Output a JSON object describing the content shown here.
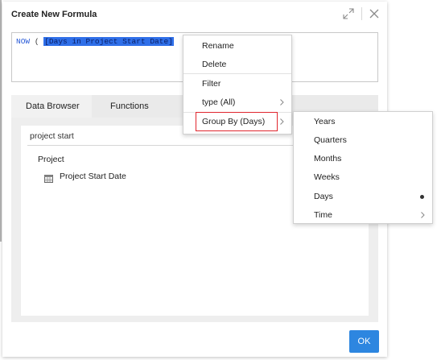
{
  "dialog": {
    "title": "Create New Formula",
    "expand_icon": "expand-icon",
    "close_icon": "close-icon"
  },
  "formula": {
    "function_name": "NOW",
    "open_paren": "(",
    "argument": "[Days in Project Start Date]"
  },
  "tabs": [
    {
      "label": "Data Browser",
      "active": true
    },
    {
      "label": "Functions",
      "active": false
    }
  ],
  "data_browser": {
    "search_value": "project start",
    "group": "Project",
    "items": [
      {
        "label": "Project Start Date",
        "icon": "table-icon"
      }
    ]
  },
  "context_menu": {
    "items": [
      {
        "label": "Rename"
      },
      {
        "label": "Delete"
      },
      {
        "label": "Filter"
      },
      {
        "label": "type (All)",
        "has_submenu": true
      },
      {
        "label": "Group By (Days)",
        "has_submenu": true,
        "highlighted": true
      }
    ]
  },
  "group_by_submenu": {
    "items": [
      {
        "label": "Years"
      },
      {
        "label": "Quarters"
      },
      {
        "label": "Months"
      },
      {
        "label": "Weeks"
      },
      {
        "label": "Days",
        "selected": true
      },
      {
        "label": "Time",
        "has_submenu": true
      }
    ]
  },
  "footer": {
    "ok_label": "OK"
  },
  "colors": {
    "accent": "#2d86e0",
    "highlight_border": "#e0262e",
    "selection": "#2f6fe8"
  }
}
